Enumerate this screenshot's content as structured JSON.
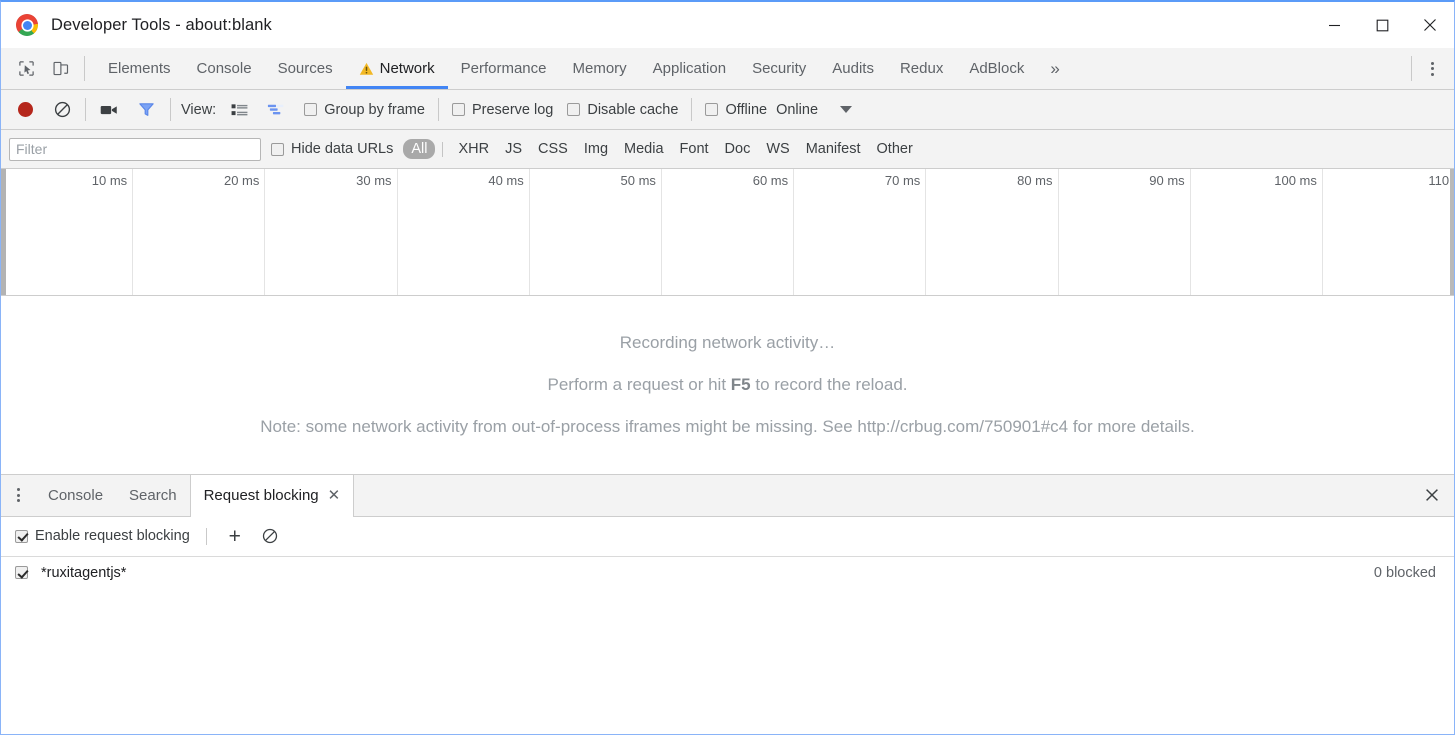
{
  "window": {
    "title": "Developer Tools - about:blank",
    "logo_icon": "chrome-logo-icon",
    "minimize_icon": "minimize-icon",
    "maximize_icon": "maximize-icon",
    "close_icon": "close-icon"
  },
  "toolstrip": {
    "inspect_icon": "inspect-element-icon",
    "device_icon": "device-toolbar-icon",
    "overflow_label": "»",
    "main_menu_icon": "kebab-menu-icon"
  },
  "tabs": [
    {
      "label": "Elements",
      "active": false,
      "warning": false
    },
    {
      "label": "Console",
      "active": false,
      "warning": false
    },
    {
      "label": "Sources",
      "active": false,
      "warning": false
    },
    {
      "label": "Network",
      "active": true,
      "warning": true
    },
    {
      "label": "Performance",
      "active": false,
      "warning": false
    },
    {
      "label": "Memory",
      "active": false,
      "warning": false
    },
    {
      "label": "Application",
      "active": false,
      "warning": false
    },
    {
      "label": "Security",
      "active": false,
      "warning": false
    },
    {
      "label": "Audits",
      "active": false,
      "warning": false
    },
    {
      "label": "Redux",
      "active": false,
      "warning": false
    },
    {
      "label": "AdBlock",
      "active": false,
      "warning": false
    }
  ],
  "network_toolbar": {
    "record_icon": "record-button-icon",
    "record_active": true,
    "clear_icon": "clear-icon",
    "screenshot_icon": "camera-icon",
    "filter_icon": "filter-funnel-icon",
    "filter_active": true,
    "view_label": "View:",
    "view_list_icon": "list-view-icon",
    "view_waterfall_icon": "waterfall-view-icon",
    "group_by_frame": {
      "label": "Group by frame",
      "checked": false
    },
    "preserve_log": {
      "label": "Preserve log",
      "checked": false
    },
    "disable_cache": {
      "label": "Disable cache",
      "checked": false
    },
    "offline": {
      "label": "Offline",
      "checked": false
    },
    "throttling": {
      "value": "Online",
      "caret_icon": "chevron-down-icon"
    }
  },
  "filter_bar": {
    "input_value": "",
    "input_placeholder": "Filter",
    "hide_data_urls": {
      "label": "Hide data URLs",
      "checked": false
    },
    "types": [
      {
        "label": "All",
        "active": true
      },
      {
        "label": "XHR",
        "active": false
      },
      {
        "label": "JS",
        "active": false
      },
      {
        "label": "CSS",
        "active": false
      },
      {
        "label": "Img",
        "active": false
      },
      {
        "label": "Media",
        "active": false
      },
      {
        "label": "Font",
        "active": false
      },
      {
        "label": "Doc",
        "active": false
      },
      {
        "label": "WS",
        "active": false
      },
      {
        "label": "Manifest",
        "active": false
      },
      {
        "label": "Other",
        "active": false
      }
    ]
  },
  "timeline": {
    "ticks": [
      "10 ms",
      "20 ms",
      "30 ms",
      "40 ms",
      "50 ms",
      "60 ms",
      "70 ms",
      "80 ms",
      "90 ms",
      "100 ms",
      "110"
    ]
  },
  "empty_state": {
    "line1": "Recording network activity…",
    "line2_before": "Perform a request or hit ",
    "line2_key": "F5",
    "line2_after": " to record the reload.",
    "line3": "Note: some network activity from out-of-process iframes might be missing. See http://crbug.com/750901#c4 for more details."
  },
  "drawer": {
    "menu_icon": "kebab-menu-icon",
    "tabs": [
      {
        "label": "Console",
        "active": false,
        "closable": false
      },
      {
        "label": "Search",
        "active": false,
        "closable": false
      },
      {
        "label": "Request blocking",
        "active": true,
        "closable": true,
        "close_icon": "close-icon"
      }
    ],
    "close_icon": "close-icon",
    "request_blocking": {
      "enable": {
        "label": "Enable request blocking",
        "checked": true
      },
      "add_icon": "plus-icon",
      "add_label": "+",
      "clear_icon": "clear-all-icon",
      "rows": [
        {
          "pattern": "*ruxitagentjs*",
          "checked": true,
          "count": "0 blocked"
        }
      ]
    }
  },
  "colors": {
    "accent": "#4285f4",
    "record_red": "#b5271c",
    "filter_blue": "#6b93f0",
    "warning_yellow": "#f2b824",
    "toolbar_bg": "#f3f3f3",
    "text": "#3c4043",
    "muted_text": "#9aa0a6"
  }
}
